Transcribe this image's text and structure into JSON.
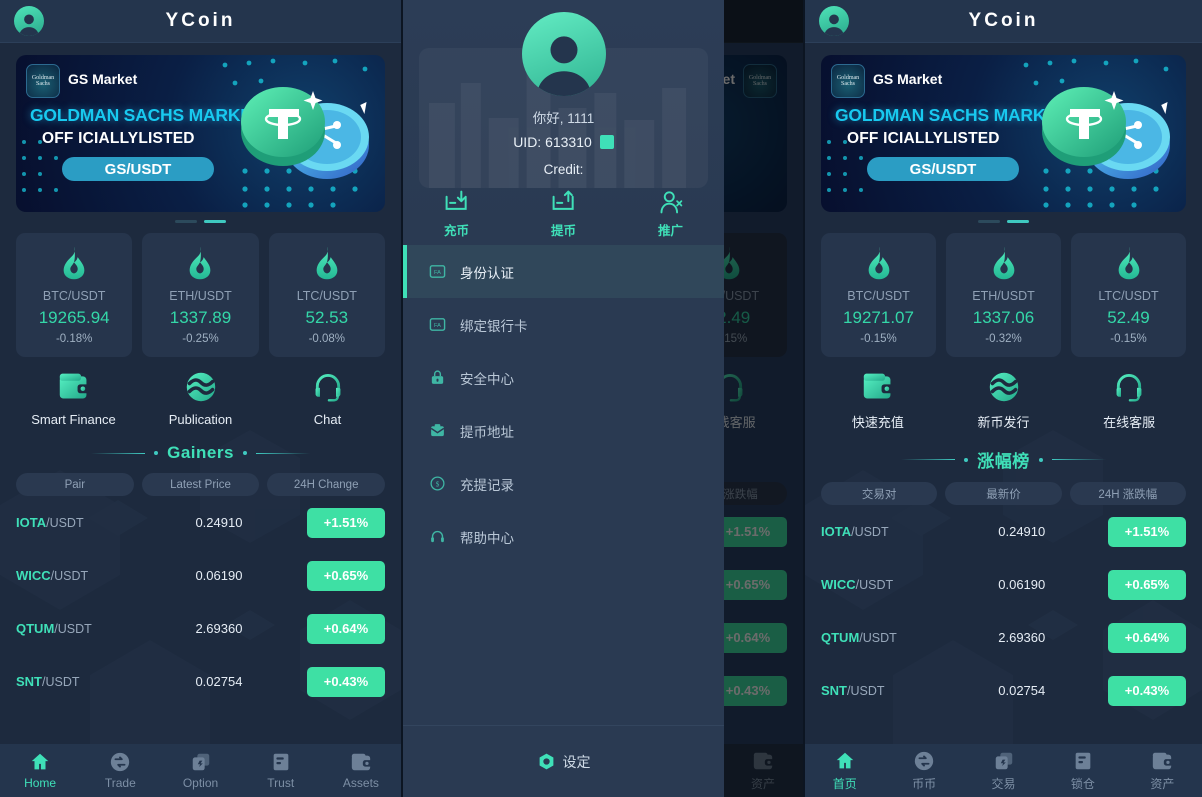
{
  "header": {
    "title": "YCoin",
    "avatar_icon": "user-avatar-icon"
  },
  "banner": {
    "logo_text": "Goldman Sachs",
    "brand": "GS Market",
    "headline": "GOLDMAN SACHS MARKETS",
    "subheadline": "OFF ICIALLYLISTED",
    "pill": "GS/USDT",
    "dots": [
      "",
      ""
    ],
    "active_dot": 1
  },
  "en": {
    "tickers": [
      {
        "pair": "BTC/USDT",
        "price": "19265.94",
        "change": "-0.18%"
      },
      {
        "pair": "ETH/USDT",
        "price": "1337.89",
        "change": "-0.25%"
      },
      {
        "pair": "LTC/USDT",
        "price": "52.53",
        "change": "-0.08%"
      }
    ],
    "quick_actions": [
      {
        "label": "Smart Finance",
        "icon": "wallet-icon"
      },
      {
        "label": "Publication",
        "icon": "token-issue-icon"
      },
      {
        "label": "Chat",
        "icon": "headset-icon"
      }
    ],
    "section_title": "Gainers",
    "columns": [
      "Pair",
      "Latest Price",
      "24H Change"
    ],
    "rows": [
      {
        "base": "IOTA",
        "quote": "/USDT",
        "price": "0.24910",
        "change": "+1.51%"
      },
      {
        "base": "WICC",
        "quote": "/USDT",
        "price": "0.06190",
        "change": "+0.65%"
      },
      {
        "base": "QTUM",
        "quote": "/USDT",
        "price": "2.69360",
        "change": "+0.64%"
      },
      {
        "base": "SNT",
        "quote": "/USDT",
        "price": "0.02754",
        "change": "+0.43%"
      }
    ],
    "bottom_nav": [
      {
        "label": "Home",
        "icon": "home-icon",
        "active": true
      },
      {
        "label": "Trade",
        "icon": "swap-icon",
        "active": false
      },
      {
        "label": "Option",
        "icon": "option-icon",
        "active": false
      },
      {
        "label": "Trust",
        "icon": "trust-icon",
        "active": false
      },
      {
        "label": "Assets",
        "icon": "assets-wallet-icon",
        "active": false
      }
    ]
  },
  "zh": {
    "tickers": [
      {
        "pair": "BTC/USDT",
        "price": "19271.07",
        "change": "-0.15%"
      },
      {
        "pair": "ETH/USDT",
        "price": "1337.06",
        "change": "-0.32%"
      },
      {
        "pair": "LTC/USDT",
        "price": "52.49",
        "change": "-0.15%"
      }
    ],
    "quick_actions": [
      {
        "label": "快速充值",
        "icon": "wallet-icon"
      },
      {
        "label": "新币发行",
        "icon": "token-issue-icon"
      },
      {
        "label": "在线客服",
        "icon": "headset-icon"
      }
    ],
    "section_title": "涨幅榜",
    "columns": [
      "交易对",
      "最新价",
      "24H 涨跌幅"
    ],
    "rows": [
      {
        "base": "IOTA",
        "quote": "/USDT",
        "price": "0.24910",
        "change": "+1.51%"
      },
      {
        "base": "WICC",
        "quote": "/USDT",
        "price": "0.06190",
        "change": "+0.65%"
      },
      {
        "base": "QTUM",
        "quote": "/USDT",
        "price": "2.69360",
        "change": "+0.64%"
      },
      {
        "base": "SNT",
        "quote": "/USDT",
        "price": "0.02754",
        "change": "+0.43%"
      }
    ],
    "bottom_nav": [
      {
        "label": "首页",
        "icon": "home-icon",
        "active": true
      },
      {
        "label": "币币",
        "icon": "swap-icon",
        "active": false
      },
      {
        "label": "交易",
        "icon": "option-icon",
        "active": false
      },
      {
        "label": "锁仓",
        "icon": "trust-icon",
        "active": false
      },
      {
        "label": "资产",
        "icon": "assets-wallet-icon",
        "active": false
      }
    ]
  },
  "drawer": {
    "greeting": "你好, 1111",
    "uid": "UID: 613310",
    "credit": "Credit:",
    "actions": [
      {
        "label": "充币",
        "icon": "deposit-icon"
      },
      {
        "label": "提币",
        "icon": "withdraw-icon"
      },
      {
        "label": "推广",
        "icon": "promote-user-icon"
      }
    ],
    "menu": [
      {
        "label": "身份认证",
        "icon": "id-card-icon",
        "active": true
      },
      {
        "label": "绑定银行卡",
        "icon": "bank-card-icon",
        "active": false
      },
      {
        "label": "安全中心",
        "icon": "lock-icon",
        "active": false
      },
      {
        "label": "提币地址",
        "icon": "address-book-icon",
        "active": false
      },
      {
        "label": "充提记录",
        "icon": "record-coin-icon",
        "active": false
      },
      {
        "label": "帮助中心",
        "icon": "headset-icon",
        "active": false
      }
    ],
    "settings": {
      "label": "设定",
      "icon": "gear-icon"
    }
  },
  "colors": {
    "accent_green": "#3fe0b8",
    "pill_green": "#3ee0a4",
    "panel_bg": "#1d2a3e",
    "card_bg": "#26354c",
    "header_bg": "#24354d",
    "drawer_bg": "#2a3a52",
    "banner_cyan": "#18c9ef",
    "banner_pill": "#2b9dc4"
  }
}
